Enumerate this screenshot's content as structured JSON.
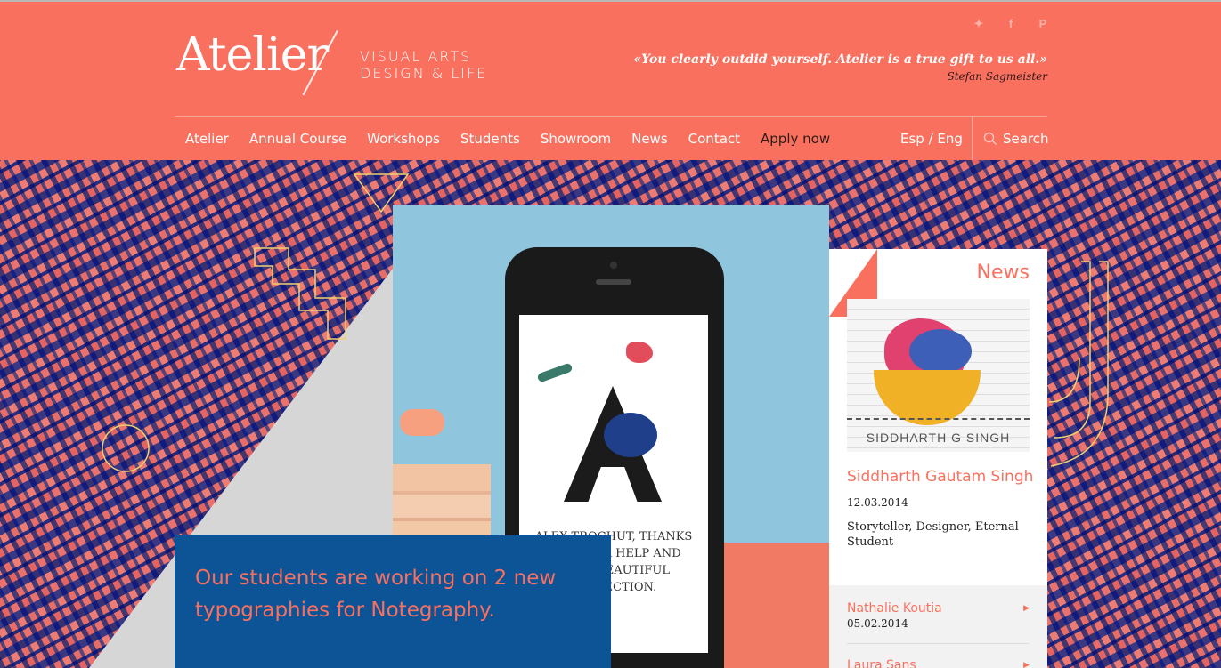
{
  "brand": {
    "logo_word": "Atelier",
    "tagline_line1": "VISUAL ARTS",
    "tagline_line2": "DESIGN & LIFE"
  },
  "social": [
    "twitter-icon",
    "facebook-icon",
    "pinterest-icon"
  ],
  "quote": {
    "text": "«You clearly outdid yourself. Atelier is a true gift to us all.»",
    "author": "Stefan Sagmeister"
  },
  "nav": {
    "items": [
      "Atelier",
      "Annual Course",
      "Workshops",
      "Students",
      "Showroom",
      "News",
      "Contact",
      "Apply now"
    ],
    "language": "Esp / Eng",
    "search_label": "Search"
  },
  "hero": {
    "phone_text": "ALEX TROCHUT, THANKS FOR YOUR HELP AND YOUR BEAUTIFUL COLLECTION.",
    "headline": "Our students are working on 2 new typographies for Notegraphy."
  },
  "news": {
    "title": "News",
    "image_caption": "SIDDHARTH G SINGH",
    "featured": {
      "name": "Siddharth Gautam Singh",
      "date": "12.03.2014",
      "description": "Storyteller, Designer, Eternal Student"
    },
    "list": [
      {
        "name": "Nathalie Koutia",
        "date": "05.02.2014"
      },
      {
        "name": "Laura Sans",
        "date": ""
      }
    ]
  },
  "colors": {
    "accent": "#f9705f",
    "dark_blue": "#0d5497",
    "pattern_blue": "#2c3da8",
    "pattern_pink": "#f09a98"
  }
}
